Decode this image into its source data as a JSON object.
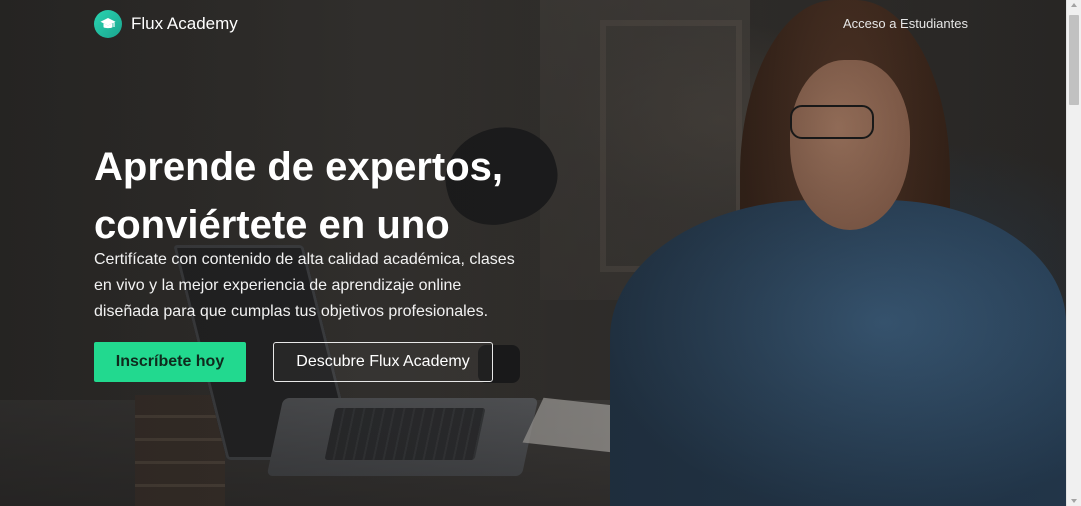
{
  "brand": {
    "name": "Flux Academy",
    "logo_icon": "graduation-cap-icon",
    "logo_color": "#22cfa9"
  },
  "nav": {
    "student_access": "Acceso a Estudiantes"
  },
  "hero": {
    "title_line1": "Aprende de expertos,",
    "title_line2": "conviértete en uno",
    "subtitle": "Certifícate con contenido de alta calidad académica, clases en vivo y la mejor experiencia de aprendizaje online diseñada para que cumplas tus objetivos profesionales.",
    "primary_cta": "Inscríbete hoy",
    "secondary_cta": "Descubre Flux Academy"
  },
  "colors": {
    "accent": "#22d98f",
    "text_on_dark": "#ffffff"
  }
}
